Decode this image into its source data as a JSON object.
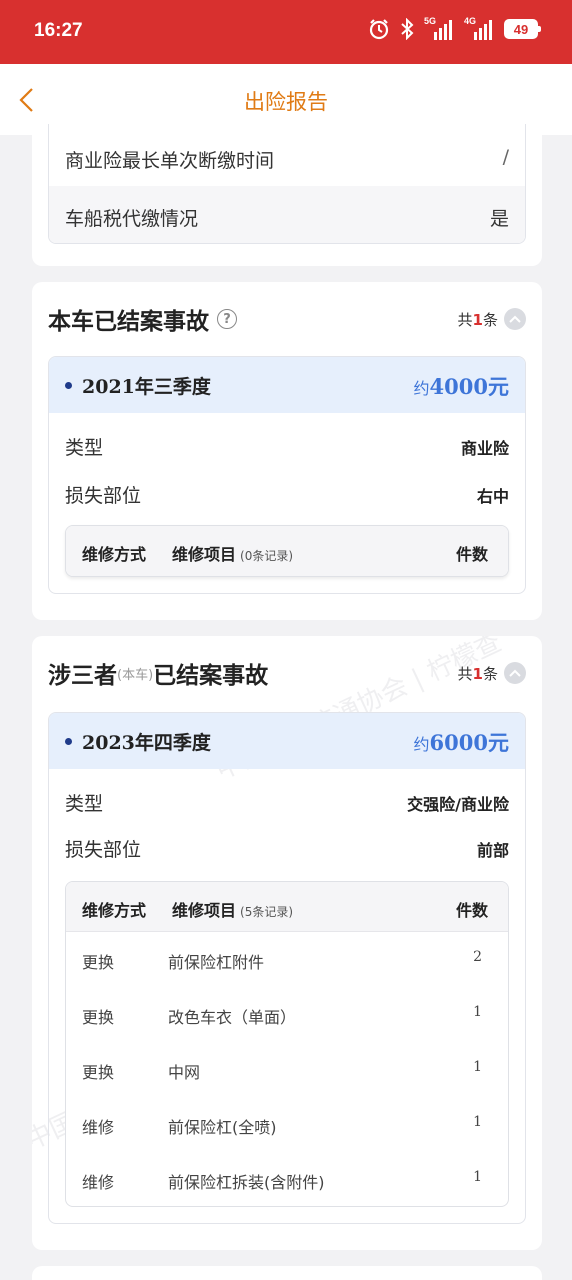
{
  "status_bar": {
    "time": "16:27",
    "net1": "5G",
    "net2": "4G",
    "battery": "49"
  },
  "nav": {
    "title": "出险报告"
  },
  "top_card": {
    "rows": [
      {
        "label": "商业险最长单次断缴时间",
        "value": "/"
      },
      {
        "label": "车船税代缴情况",
        "value": "是"
      }
    ]
  },
  "section1": {
    "title": "本车已结案事故",
    "count_prefix": "共",
    "count": "1",
    "count_suffix": "条",
    "accident": {
      "period": "2021年三季度",
      "amount_prefix": "约",
      "amount": "4000元",
      "type_label": "类型",
      "type_value": "商业险",
      "part_label": "损失部位",
      "part_value": "右中",
      "table": {
        "col1": "维修方式",
        "col2": "维修项目",
        "col2_sub": "(0条记录)",
        "col3": "件数",
        "rows": []
      }
    }
  },
  "section2": {
    "title_a": "涉三者",
    "title_small": "(本车)",
    "title_b": "已结案事故",
    "count_prefix": "共",
    "count": "1",
    "count_suffix": "条",
    "accident": {
      "period": "2023年四季度",
      "amount_prefix": "约",
      "amount": "6000元",
      "type_label": "类型",
      "type_value": "交强险/商业险",
      "part_label": "损失部位",
      "part_value": "前部",
      "table": {
        "col1": "维修方式",
        "col2": "维修项目",
        "col2_sub": "(5条记录)",
        "col3": "件数",
        "rows": [
          {
            "method": "更换",
            "item": "前保险杠附件",
            "qty": "2"
          },
          {
            "method": "更换",
            "item": "改色车衣（单面）",
            "qty": "1"
          },
          {
            "method": "更换",
            "item": "中网",
            "qty": "1"
          },
          {
            "method": "维修",
            "item": "前保险杠(全喷)",
            "qty": "1"
          },
          {
            "method": "维修",
            "item": "前保险杠拆装(含附件)",
            "qty": "1"
          }
        ]
      }
    }
  },
  "watermark": {
    "text": "中国汽车流通协会 | 柠檬查"
  },
  "colors": {
    "status_bar": "#d8302f",
    "title": "#e07b15",
    "amount": "#3e75d8",
    "count": "#d8302f",
    "accident_header": "#e6effc"
  }
}
